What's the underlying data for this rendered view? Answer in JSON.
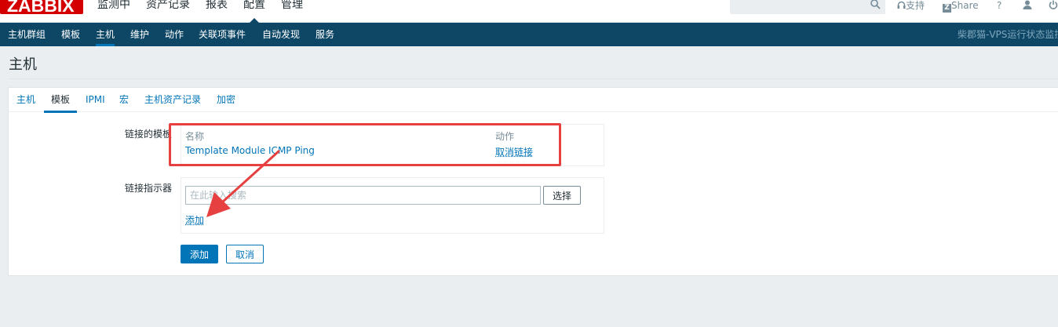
{
  "app": {
    "logo": "ZABBIX"
  },
  "main_nav": [
    "监测中",
    "资产记录",
    "报表",
    "配置",
    "管理"
  ],
  "top_links": {
    "support": "支持",
    "share": "Share",
    "help": "?"
  },
  "sub_nav": {
    "items": [
      "主机群组",
      "模板",
      "主机",
      "维护",
      "动作",
      "关联项事件",
      "自动发现",
      "服务"
    ],
    "right_text": "柴郡猫-VPS运行状态监控"
  },
  "page": {
    "title": "主机"
  },
  "tabs": [
    "主机",
    "模板",
    "IPMI",
    "宏",
    "主机资产记录",
    "加密"
  ],
  "form": {
    "linked_templates_label": "链接的模板",
    "table_headers": {
      "name": "名称",
      "action": "动作"
    },
    "linked_template": {
      "name": "Template Module ICMP Ping",
      "action": "取消链接"
    },
    "link_indicator_label": "链接指示器",
    "search_placeholder": "在此输入搜索",
    "select_button": "选择",
    "add_link": "添加",
    "add_button": "添加",
    "cancel_button": "取消"
  },
  "colors": {
    "header_bg": "#0e4765",
    "accent": "#0275b8",
    "logo_red": "#d40000",
    "annotation_red": "#e64040"
  }
}
